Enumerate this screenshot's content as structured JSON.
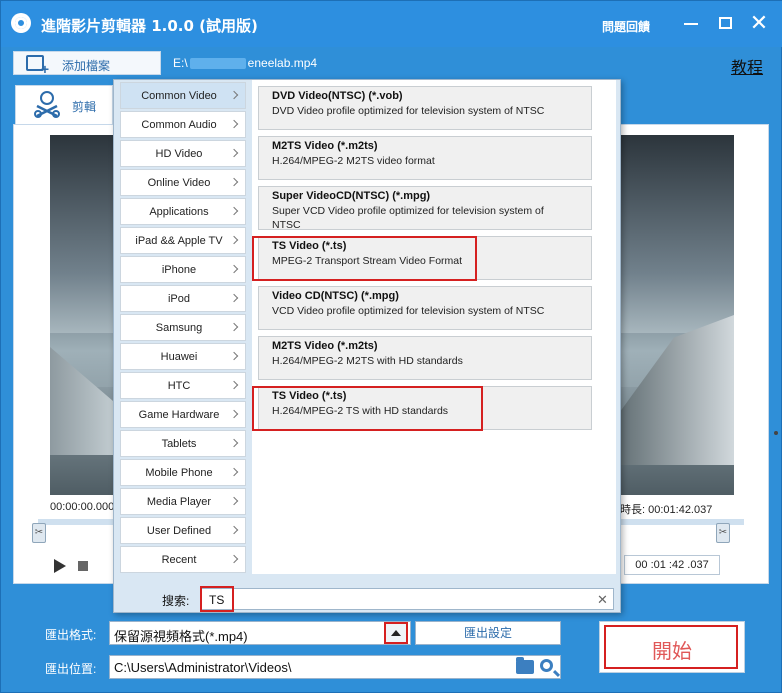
{
  "titlebar": {
    "app_title": "進階影片剪輯器 1.0.0 (試用版)",
    "feedback": "問題回饋",
    "close_glyph": "✕"
  },
  "toolbar": {
    "add_file_label": "添加檔案",
    "file_path_prefix": "E:\\",
    "file_path_suffix": "eneelab.mp4",
    "tutorial_label": "教程"
  },
  "tabs": [
    {
      "label": "剪輯"
    }
  ],
  "player": {
    "time_start": "00:00:00.000",
    "duration": "時長:  00:01:42.037",
    "time_box": "00 :01 :42 .037"
  },
  "categories": [
    {
      "label": "Common Video"
    },
    {
      "label": "Common Audio"
    },
    {
      "label": "HD Video"
    },
    {
      "label": "Online Video"
    },
    {
      "label": "Applications"
    },
    {
      "label": "iPad && Apple TV"
    },
    {
      "label": "iPhone"
    },
    {
      "label": "iPod"
    },
    {
      "label": "Samsung"
    },
    {
      "label": "Huawei"
    },
    {
      "label": "HTC"
    },
    {
      "label": "Game Hardware"
    },
    {
      "label": "Tablets"
    },
    {
      "label": "Mobile Phone"
    },
    {
      "label": "Media Player"
    },
    {
      "label": "User Defined"
    },
    {
      "label": "Recent"
    }
  ],
  "selected_category": "Common Video",
  "formats": [
    {
      "title": "DVD Video(NTSC) (*.vob)",
      "desc": "DVD Video profile optimized for television system of NTSC"
    },
    {
      "title": "M2TS Video (*.m2ts)",
      "desc": "H.264/MPEG-2 M2TS video format"
    },
    {
      "title": "Super VideoCD(NTSC) (*.mpg)",
      "desc": "Super VCD Video profile optimized for television system of NTSC"
    },
    {
      "title": "TS Video (*.ts)",
      "desc": "MPEG-2 Transport Stream Video Format"
    },
    {
      "title": "Video CD(NTSC) (*.mpg)",
      "desc": "VCD Video profile optimized for television system of NTSC"
    },
    {
      "title": "M2TS Video (*.m2ts)",
      "desc": "H.264/MPEG-2 M2TS with HD standards"
    },
    {
      "title": "TS Video (*.ts)",
      "desc": "H.264/MPEG-2 TS with HD standards"
    }
  ],
  "search": {
    "label": "搜索:",
    "value": "TS",
    "clear_glyph": "✕"
  },
  "bottom": {
    "format_label": "匯出格式:",
    "format_value": "保留源視頻格式(*.mp4)",
    "export_settings": "匯出設定",
    "location_label": "匯出位置:",
    "location_value": "C:\\Users\\Administrator\\Videos\\",
    "start_label": "開始"
  },
  "colors": {
    "accent": "#2d8fe0",
    "highlight": "#d52020"
  }
}
